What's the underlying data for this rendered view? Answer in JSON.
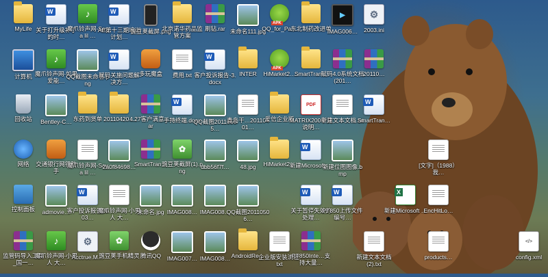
{
  "desktop": {
    "icons": [
      {
        "label": "MyLife",
        "type": "folder"
      },
      {
        "label": "关于打升级补丁的时…",
        "type": "word"
      },
      {
        "label": "魔爪铃声网-Say a lil …",
        "type": "green"
      },
      {
        "label": "AE第十三期培训计划…",
        "type": "word"
      },
      {
        "label": "豌豆荚截屏.png",
        "type": "phone"
      },
      {
        "label": "北京诺华药品监管方案",
        "type": "folder"
      },
      {
        "label": "刷钻.rar",
        "type": "rar"
      },
      {
        "label": "未命名111.jpg",
        "type": "jpg"
      },
      {
        "label": "QQ_for_Pa…",
        "type": "apk"
      },
      {
        "label": "东北制药改进单",
        "type": "folder"
      },
      {
        "label": "IMAG006…",
        "type": "video"
      },
      {
        "label": "2003.ini",
        "type": "gear"
      },
      {
        "label": "计算机",
        "type": "computer"
      },
      {
        "label": "魔爪铃声网-如果爱能…",
        "type": "green"
      },
      {
        "label": "QQ截图未命名.png",
        "type": "jpg"
      },
      {
        "label": "赋码关施问题解决方…",
        "type": "word"
      },
      {
        "label": "多玩魔盒",
        "type": "app"
      },
      {
        "label": "费用.txt",
        "type": "txt"
      },
      {
        "label": "客户投诉报告-3.docx",
        "type": "word"
      },
      {
        "label": "INTER",
        "type": "folder"
      },
      {
        "label": "HiMarket2…",
        "type": "apk"
      },
      {
        "label": "SmartTran…",
        "type": "folder"
      },
      {
        "label": "赋码4.0系统文档(201…",
        "type": "rar"
      },
      {
        "label": "20110…",
        "type": "rar"
      },
      {
        "label": "回收站",
        "type": "bin"
      },
      {
        "label": "Bentley-C…",
        "type": "jpg"
      },
      {
        "label": "东药到货单",
        "type": "folder"
      },
      {
        "label": "20110420…",
        "type": "folder"
      },
      {
        "label": "4.27客户满意…rar",
        "type": "rar"
      },
      {
        "label": "手持终端.docx",
        "type": "word"
      },
      {
        "label": "QQ截图20110505…",
        "type": "jpg"
      },
      {
        "label": "青岛干…20110401…",
        "type": "txt"
      },
      {
        "label": "爱信企业版",
        "type": "folder"
      },
      {
        "label": "MATRIX200中文说明…",
        "type": "pdf"
      },
      {
        "label": "新建文本文档.txt",
        "type": "txt"
      },
      {
        "label": "SmartTran…",
        "type": "word"
      },
      {
        "label": "网络",
        "type": "network"
      },
      {
        "label": "交通银行网银助手",
        "type": "app"
      },
      {
        "label": "魔爪铃声网-Say a lil …",
        "type": "txt"
      },
      {
        "label": "2a0f84698…",
        "type": "jpg"
      },
      {
        "label": "SmartTran…",
        "type": "rar"
      },
      {
        "label": "豌豆荚截屏(1).png",
        "type": "game"
      },
      {
        "label": "dbb56f7f…",
        "type": "jpg"
      },
      {
        "label": "48.jpg",
        "type": "jpg"
      },
      {
        "label": "HiMarket2…",
        "type": "folder"
      },
      {
        "label": "新建Microsoft …",
        "type": "word"
      },
      {
        "label": "新建位图图像.bmp",
        "type": "jpg"
      },
      {
        "label": "[文字]（1988）我…",
        "type": "txt"
      },
      {
        "label": "控制面板",
        "type": "control"
      },
      {
        "label": "admovie…",
        "type": "jpg"
      },
      {
        "label": "客户投诉报告2003…",
        "type": "word"
      },
      {
        "label": "魔爪铃声网-小男人 大…",
        "type": "txt"
      },
      {
        "label": "未命名.jpg",
        "type": "jpg"
      },
      {
        "label": "IMAG008…",
        "type": "jpg"
      },
      {
        "label": "IMAG008…",
        "type": "jpg"
      },
      {
        "label": "QQ截图20110506…",
        "type": "jpg"
      },
      {
        "label": "关于暂停失效的处理…",
        "type": "word"
      },
      {
        "label": "PT850上传文件编号…",
        "type": "word"
      },
      {
        "label": "新建Microsoft …",
        "type": "xls"
      },
      {
        "label": "EncHitLo…",
        "type": "txt"
      },
      {
        "label": "监管码导入工具_国一…",
        "type": "rar"
      },
      {
        "label": "魔爪铃声网-小男人 大…",
        "type": "green"
      },
      {
        "label": "Acctrue.M…",
        "type": "gear"
      },
      {
        "label": "豌豆荚手机精灵",
        "type": "game"
      },
      {
        "label": "腾讯QQ",
        "type": "qq"
      },
      {
        "label": "IMAG007…",
        "type": "jpg"
      },
      {
        "label": "IMAG008…",
        "type": "jpg"
      },
      {
        "label": "AndroidRe…",
        "type": "folder"
      },
      {
        "label": "企业版安装流程.txt",
        "type": "txt"
      },
      {
        "label": "PT850Inte…支持大量…",
        "type": "rar"
      },
      {
        "label": "新建文本文档 (2).txt",
        "type": "txt"
      },
      {
        "label": "products…",
        "type": "txt"
      },
      {
        "label": "config.xml",
        "type": "xml"
      }
    ]
  }
}
